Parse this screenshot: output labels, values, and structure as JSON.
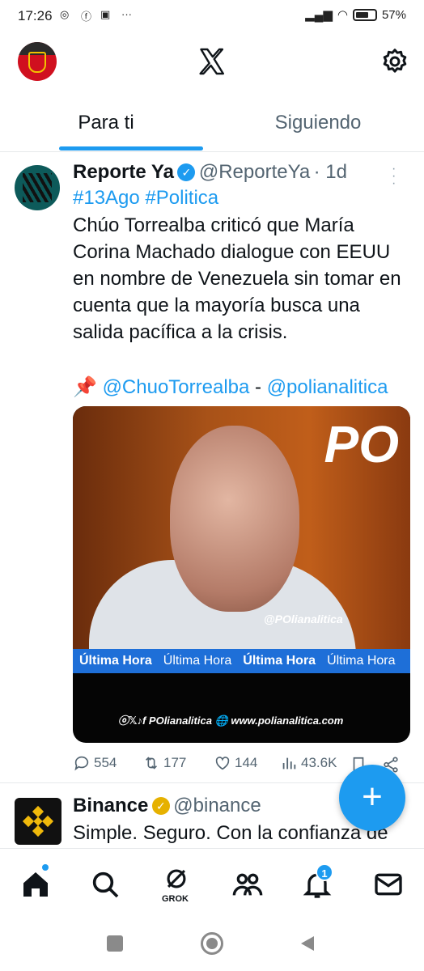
{
  "status_bar": {
    "time": "17:26",
    "battery": "57%"
  },
  "tabs": [
    {
      "label": "Para ti"
    },
    {
      "label": "Siguiendo"
    }
  ],
  "tweet1": {
    "name": "Reporte Ya",
    "handle": "@ReporteYa",
    "time": "· 1d",
    "hashtags": "#13Ago #Politica",
    "text": "Chúo Torrealba criticó que María Corina Machado dialogue con EEUU en nombre de Venezuela sin tomar en cuenta que la mayoría busca una salida pacífica a la crisis.",
    "pin": "📌",
    "mention1": "@ChuoTorrealba",
    "dash": " - ",
    "mention2": "@polianalitica",
    "media": {
      "logo": "PO",
      "watermark": "@POlianalitica",
      "ticker": [
        "Última Hora",
        "Última Hora",
        "Última Hora",
        "Última Hora"
      ],
      "footer": "ⓞ𝕏♪f POlianalitica  🌐 www.polianalitica.com"
    },
    "stats": {
      "replies": "554",
      "reposts": "177",
      "likes": "144",
      "views": "43.6K"
    }
  },
  "tweet2": {
    "name": "Binance",
    "handle": "@binance",
    "text": "Simple. Seguro. Con la confianza de"
  },
  "fab": {
    "label": "+"
  },
  "bottom_nav": {
    "grok_label": "GROK",
    "notif_count": "1"
  },
  "colors": {
    "accent": "#1d9bf0",
    "text": "#0f1419",
    "muted": "#536471"
  }
}
